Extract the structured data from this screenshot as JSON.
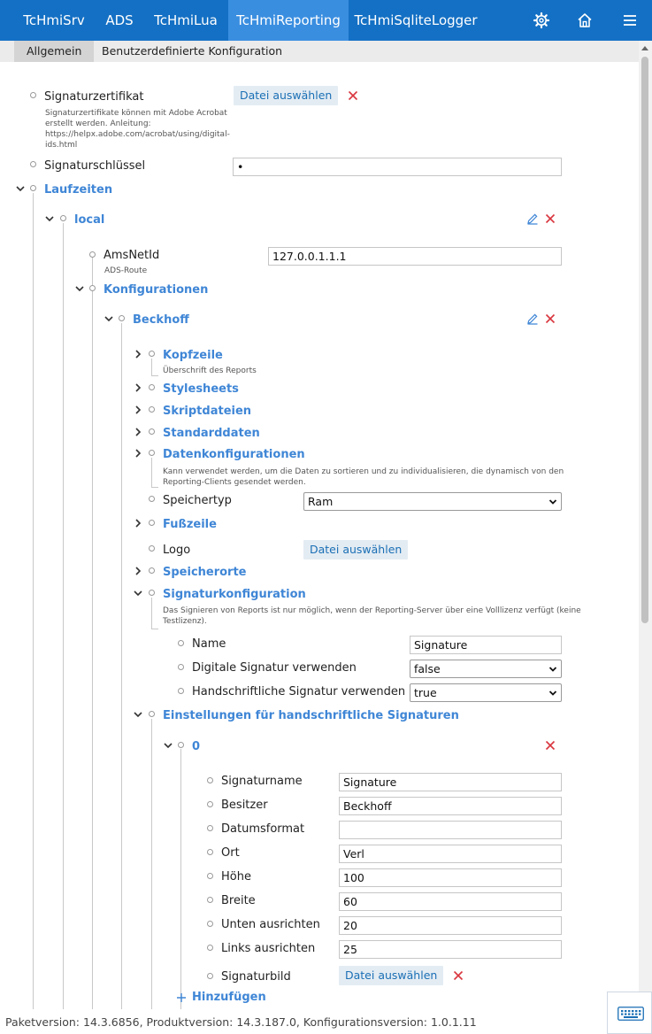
{
  "nav": {
    "tabs": [
      "TcHmiSrv",
      "ADS",
      "TcHmiLua",
      "TcHmiReporting",
      "TcHmiSqliteLogger"
    ],
    "active_tab": "TcHmiReporting",
    "icons": [
      "gear-icon",
      "home-icon",
      "menu-icon"
    ],
    "color": "#1470c4",
    "active_color": "#3a8ee0"
  },
  "subtabs": [
    "Allgemein",
    "Benutzerdefinierte Konfiguration"
  ],
  "fields": {
    "signaturzertifikat": {
      "label": "Signaturzertifikat",
      "desc": [
        "Signaturzertifikate können mit Adobe Acrobat",
        "erstellt werden. Anleitung:",
        "https://helpx.adobe.com/acrobat/using/digital-",
        "ids.html"
      ],
      "button": "Datei auswählen"
    },
    "signaturschluessel": {
      "label": "Signaturschlüssel",
      "value": "•"
    },
    "laufzeiten": "Laufzeiten",
    "local": "local",
    "amsnetid": {
      "label": "AmsNetId",
      "desc": "ADS-Route",
      "value": "127.0.0.1.1.1"
    },
    "konfigurationen": "Konfigurationen",
    "beckhoff": "Beckhoff",
    "kopfzeile": {
      "label": "Kopfzeile",
      "desc": "Überschrift des Reports"
    },
    "stylesheets": "Stylesheets",
    "skriptdateien": "Skriptdateien",
    "standarddaten": "Standarddaten",
    "datenkonfigurationen": {
      "label": "Datenkonfigurationen",
      "desc": [
        "Kann verwendet werden, um die Daten zu sortieren und zu individualisieren, die dynamisch von den",
        "Reporting-Clients gesendet werden."
      ]
    },
    "speichertyp": {
      "label": "Speichertyp",
      "value": "Ram"
    },
    "fusszeile": "Fußzeile",
    "logo": {
      "label": "Logo",
      "button": "Datei auswählen"
    },
    "speicherorte": "Speicherorte",
    "signaturkonfiguration": {
      "label": "Signaturkonfiguration",
      "desc": [
        "Das Signieren von Reports ist nur möglich, wenn der Reporting-Server über eine Volllizenz verfügt (keine",
        "Testlizenz)."
      ]
    },
    "name": {
      "label": "Name",
      "value": "Signature"
    },
    "digitale": {
      "label": "Digitale Signatur verwenden",
      "value": "false"
    },
    "handschriftliche": {
      "label": "Handschriftliche Signatur verwenden",
      "value": "true"
    },
    "einstellungen": "Einstellungen für handschriftliche Signaturen",
    "item0": "0",
    "signaturname": {
      "label": "Signaturname",
      "value": "Signature"
    },
    "besitzer": {
      "label": "Besitzer",
      "value": "Beckhoff"
    },
    "datumsformat": {
      "label": "Datumsformat",
      "value": ""
    },
    "ort": {
      "label": "Ort",
      "value": "Verl"
    },
    "hoehe": {
      "label": "Höhe",
      "value": "100"
    },
    "breite": {
      "label": "Breite",
      "value": "60"
    },
    "unten": {
      "label": "Unten ausrichten",
      "value": "20"
    },
    "links": {
      "label": "Links ausrichten",
      "value": "25"
    },
    "signaturbild": {
      "label": "Signaturbild",
      "button": "Datei auswählen"
    },
    "hinzufuegen": "Hinzufügen"
  },
  "footer": {
    "text": "Paketversion: 14.3.6856, Produktversion: 14.3.187.0, Konfigurationsversion: 1.0.1.11",
    "keyboard_icon": "keyboard-icon"
  },
  "colors": {
    "group_label": "#3f86d6",
    "delete": "#d9363e",
    "button_bg": "#e4ecf3",
    "button_text": "#1a6fb5"
  }
}
